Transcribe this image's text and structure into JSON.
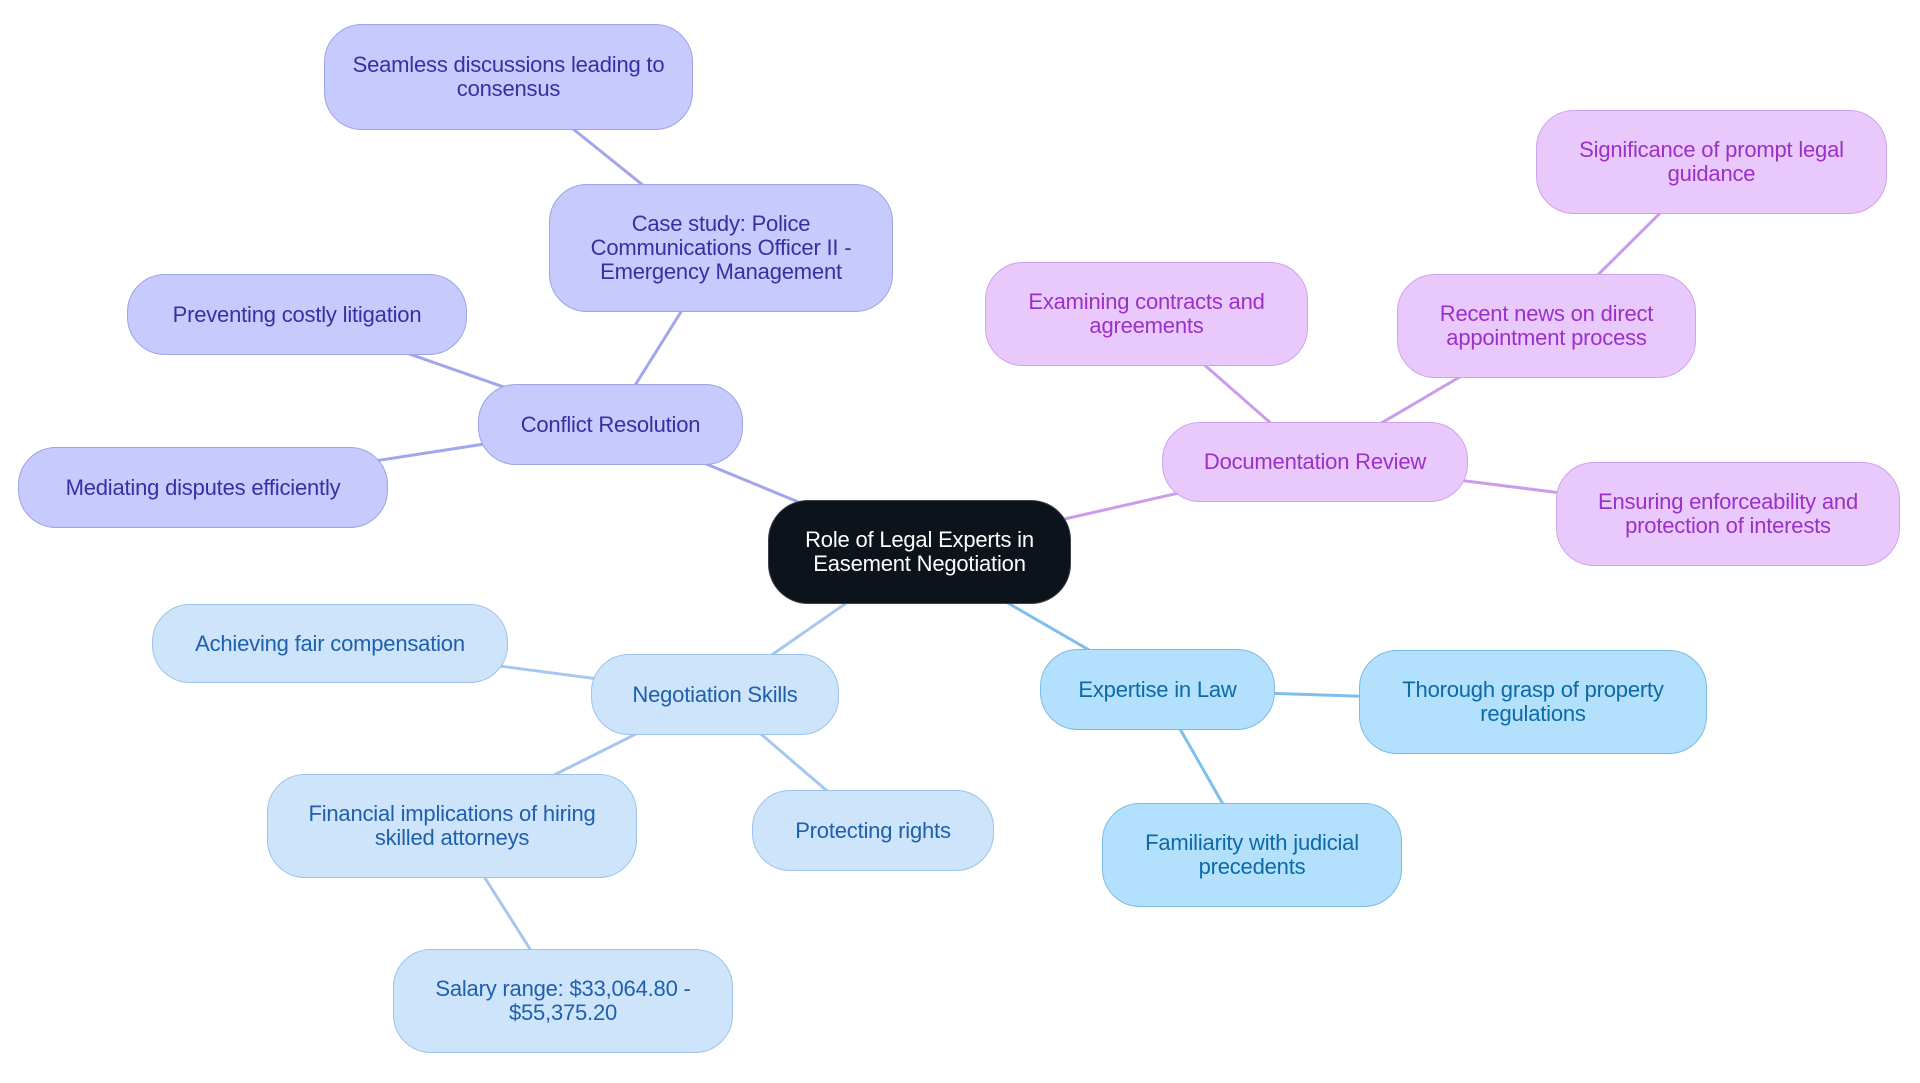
{
  "diagram": {
    "type": "mindmap",
    "root": {
      "id": "root",
      "label": "Role of Legal Experts in Easement Negotiation"
    },
    "colors": {
      "root_bg": "#0c131b",
      "conflict_branch": "#c7cafd",
      "conflict_text": "#3730a3",
      "documentation_branch": "#e9c9fc",
      "documentation_text": "#9b30c9",
      "expertise_branch": "#b3e0fc",
      "expertise_text": "#0d6aa8",
      "negotiation_branch": "#cde4fb",
      "negotiation_text": "#1e5fae"
    },
    "nodes": {
      "root": "Role of Legal Experts in Easement Negotiation",
      "conflict": "Conflict Resolution",
      "case_study": "Case study: Police Communications Officer II - Emergency Management",
      "seamless": "Seamless discussions leading to consensus",
      "preventing": "Preventing costly litigation",
      "mediating": "Mediating disputes efficiently",
      "documentation": "Documentation Review",
      "examining": "Examining contracts and agreements",
      "recent_news": "Recent news on direct appointment process",
      "significance": "Significance of prompt legal guidance",
      "ensuring": "Ensuring enforceability and protection of interests",
      "negotiation": "Negotiation Skills",
      "achieving": "Achieving fair compensation",
      "financial": "Financial implications of hiring skilled attorneys",
      "salary": "Salary range: $33,064.80 - $55,375.20",
      "protecting": "Protecting rights",
      "expertise": "Expertise in Law",
      "thorough": "Thorough grasp of property regulations",
      "familiarity": "Familiarity with judicial precedents"
    },
    "edges": [
      [
        "root",
        "conflict"
      ],
      [
        "conflict",
        "case_study"
      ],
      [
        "case_study",
        "seamless"
      ],
      [
        "conflict",
        "preventing"
      ],
      [
        "conflict",
        "mediating"
      ],
      [
        "root",
        "documentation"
      ],
      [
        "documentation",
        "examining"
      ],
      [
        "documentation",
        "recent_news"
      ],
      [
        "recent_news",
        "significance"
      ],
      [
        "documentation",
        "ensuring"
      ],
      [
        "root",
        "negotiation"
      ],
      [
        "negotiation",
        "achieving"
      ],
      [
        "negotiation",
        "financial"
      ],
      [
        "financial",
        "salary"
      ],
      [
        "negotiation",
        "protecting"
      ],
      [
        "root",
        "expertise"
      ],
      [
        "expertise",
        "thorough"
      ],
      [
        "expertise",
        "familiarity"
      ]
    ]
  }
}
